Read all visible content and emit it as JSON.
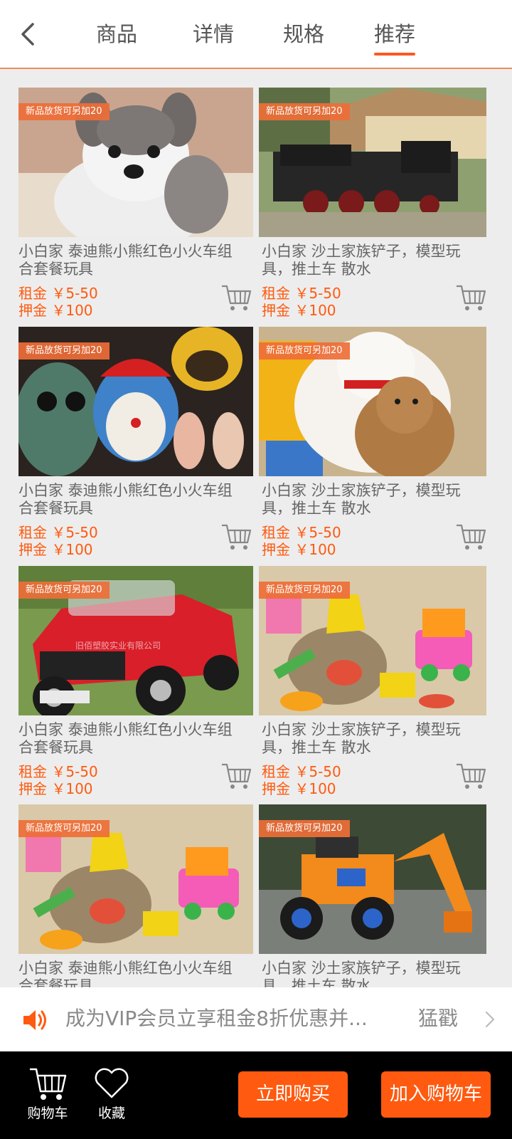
{
  "tabs": [
    {
      "label": "商品",
      "active": false
    },
    {
      "label": "详情",
      "active": false
    },
    {
      "label": "规格",
      "active": false
    },
    {
      "label": "推荐",
      "active": true
    }
  ],
  "colors": {
    "accent": "#ff5a0f",
    "badge": "#ee6e37"
  },
  "products": [
    {
      "badge": "新品放货可另加20",
      "title": "小白家 泰迪熊小熊红色小火车组合套餐玩具",
      "rent": "租金 ￥5-50",
      "deposit": "押金 ￥100",
      "image": "husky-plush"
    },
    {
      "badge": "新品放货可另加20",
      "title": "小白家 沙土家族铲子，模型玩具，推土车 散水",
      "rent": "租金 ￥5-50",
      "deposit": "押金 ￥100",
      "image": "toy-train"
    },
    {
      "badge": "新品放货可另加20",
      "title": "小白家 泰迪熊小熊红色小火车组合套餐玩具",
      "rent": "租金 ￥5-50",
      "deposit": "押金 ￥100",
      "image": "plush-figures"
    },
    {
      "badge": "新品放货可另加20",
      "title": "小白家 沙土家族铲子，模型玩具，推土车 散水",
      "rent": "租金 ￥5-50",
      "deposit": "押金 ￥100",
      "image": "teddy-bears"
    },
    {
      "badge": "新品放货可另加20",
      "title": "小白家 泰迪熊小熊红色小火车组合套餐玩具",
      "rent": "租金 ￥5-50",
      "deposit": "押金 ￥100",
      "image": "red-toy-car",
      "watermark": "旧佰塑胶实业有限公司"
    },
    {
      "badge": "新品放货可另加20",
      "title": "小白家 沙土家族铲子，模型玩具，推土车 散水",
      "rent": "租金 ￥5-50",
      "deposit": "押金 ￥100",
      "image": "sand-toys"
    },
    {
      "badge": "新品放货可另加20",
      "title": "小白家 泰迪熊小熊红色小火车组合套餐玩具",
      "rent": "",
      "deposit": "",
      "image": "sand-toys"
    },
    {
      "badge": "新品放货可另加20",
      "title": "小白家 沙土家族铲子，模型玩具，推土车 散水",
      "rent": "",
      "deposit": "",
      "image": "ride-on-excavator"
    }
  ],
  "notice": {
    "text": "成为VIP会员立享租金8折优惠并...",
    "link": "猛戳"
  },
  "bottom": {
    "cart_label": "购物车",
    "fav_label": "收藏",
    "buy_label": "立即购买",
    "add_cart_label": "加入购物车"
  }
}
